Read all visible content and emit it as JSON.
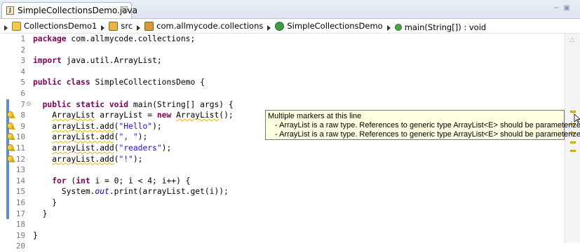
{
  "tab": {
    "title": "SimpleCollectionsDemo.java",
    "close_glyph": "☒"
  },
  "window_controls": {
    "minimize": "−",
    "maximize": "▣"
  },
  "breadcrumb": [
    {
      "label": "CollectionsDemo1",
      "icon": "project-icon"
    },
    {
      "label": "src",
      "icon": "source-folder-icon"
    },
    {
      "label": "com.allmycode.collections",
      "icon": "package-icon"
    },
    {
      "label": "SimpleCollectionsDemo",
      "icon": "class-icon"
    },
    {
      "label": "main(String[]) : void",
      "icon": "method-icon"
    }
  ],
  "lines": [
    {
      "n": "1",
      "code": "package com.allmycode.collections;"
    },
    {
      "n": "2",
      "code": ""
    },
    {
      "n": "3",
      "code": "import java.util.ArrayList;"
    },
    {
      "n": "4",
      "code": ""
    },
    {
      "n": "5",
      "code": "public class SimpleCollectionsDemo {"
    },
    {
      "n": "6",
      "code": ""
    },
    {
      "n": "7",
      "code": "  public static void main(String[] args) {"
    },
    {
      "n": "8",
      "code": "    ArrayList arrayList = new ArrayList();"
    },
    {
      "n": "9",
      "code": "    arrayList.add(\"Hello\");"
    },
    {
      "n": "10",
      "code": "    arrayList.add(\", \");"
    },
    {
      "n": "11",
      "code": "    arrayList.add(\"readers\");"
    },
    {
      "n": "12",
      "code": "    arrayList.add(\"!\");"
    },
    {
      "n": "13",
      "code": ""
    },
    {
      "n": "14",
      "code": "    for (int i = 0; i < 4; i++) {"
    },
    {
      "n": "15",
      "code": "      System.out.print(arrayList.get(i));"
    },
    {
      "n": "16",
      "code": "    }"
    },
    {
      "n": "17",
      "code": "  }"
    },
    {
      "n": "18",
      "code": ""
    },
    {
      "n": "19",
      "code": "}"
    },
    {
      "n": "20",
      "code": ""
    }
  ],
  "tooltip": {
    "heading": "Multiple markers at this line",
    "items": [
      "- ArrayList is a raw type. References to generic type ArrayList<E> should be parameterized",
      "- ArrayList is a raw type. References to generic type ArrayList<E> should be parameterized"
    ]
  },
  "colors": {
    "keyword": "#7f0055",
    "string": "#2a00ff",
    "warning": "#f0b000",
    "change_bar": "#5a8fd6"
  }
}
